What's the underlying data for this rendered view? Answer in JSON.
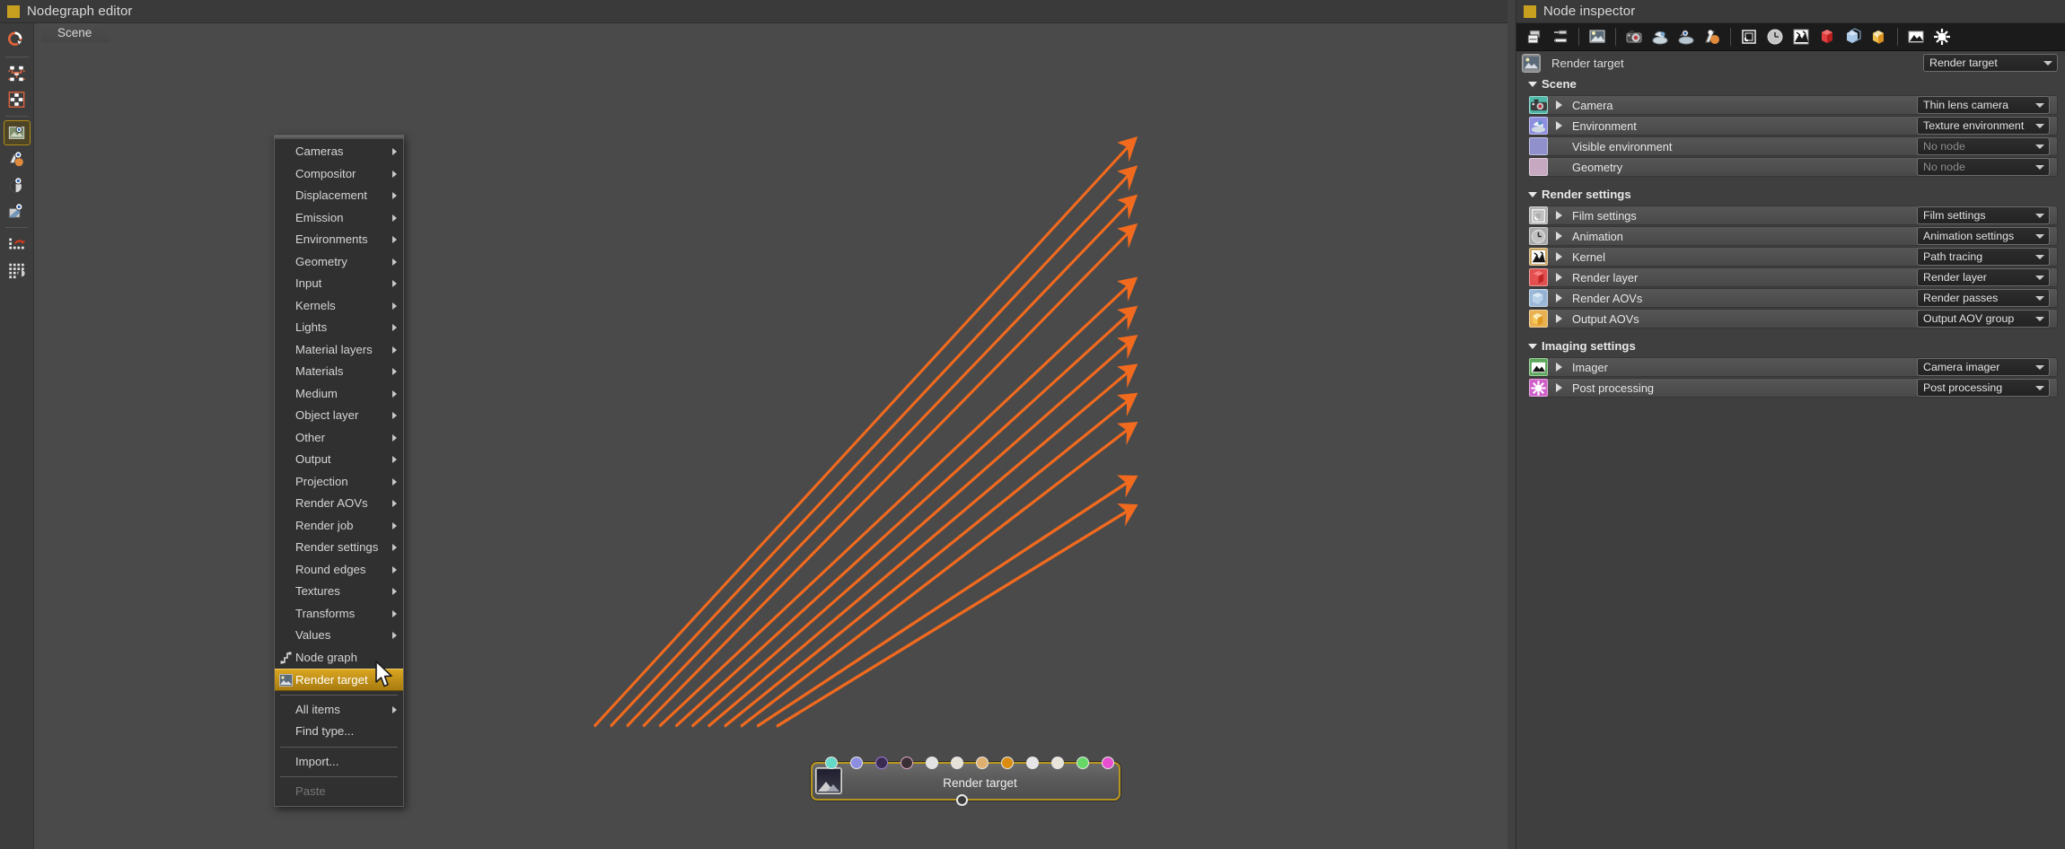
{
  "nodegraph": {
    "title": "Nodegraph editor",
    "tab": "Scene",
    "tool_rail": [
      {
        "name": "select-tool",
        "icon": "cursor-select-icon"
      },
      {
        "name": "layout-horizontal-tool",
        "icon": "layout-horizontal-icon"
      },
      {
        "name": "layout-vertical-tool",
        "icon": "layout-vertical-icon"
      },
      {
        "name": "render-target-tool",
        "icon": "render-target-icon"
      },
      {
        "name": "material-preview-tool",
        "icon": "material-ball-icon"
      },
      {
        "name": "geometry-preview-tool",
        "icon": "geometry-sphere-icon"
      },
      {
        "name": "texture-preview-tool",
        "icon": "texture-preview-icon"
      },
      {
        "name": "snap-tool",
        "icon": "snap-grid-icon"
      },
      {
        "name": "grid-tool",
        "icon": "grid-icon"
      }
    ],
    "node": {
      "label": "Render target",
      "icon": "render-target-thumbnail",
      "ports": [
        {
          "name": "camera-port",
          "color": "#66d8c8"
        },
        {
          "name": "environment-port",
          "color": "#8d8ee0"
        },
        {
          "name": "visible-environment-port",
          "color": "#3a2b52",
          "ring": "#9d7fd6"
        },
        {
          "name": "geometry-port",
          "color": "#3a2f34",
          "ring": "#e0a8c8"
        },
        {
          "name": "film-settings-port",
          "color": "#e2e2e2"
        },
        {
          "name": "animation-port",
          "color": "#e6e2d8"
        },
        {
          "name": "kernel-port",
          "color": "#e0b070"
        },
        {
          "name": "render-layer-port",
          "color": "#d98c10"
        },
        {
          "name": "render-aovs-port",
          "color": "#e6e6e6"
        },
        {
          "name": "output-aovs-port",
          "color": "#e8e4da"
        },
        {
          "name": "imager-port",
          "color": "#66d866"
        },
        {
          "name": "post-processing-port",
          "color": "#e84fd0"
        }
      ],
      "output_port": {
        "name": "output-port"
      }
    },
    "context_menu": {
      "items": [
        {
          "label": "Cameras",
          "submenu": true
        },
        {
          "label": "Compositor",
          "submenu": true
        },
        {
          "label": "Displacement",
          "submenu": true
        },
        {
          "label": "Emission",
          "submenu": true
        },
        {
          "label": "Environments",
          "submenu": true
        },
        {
          "label": "Geometry",
          "submenu": true
        },
        {
          "label": "Input",
          "submenu": true
        },
        {
          "label": "Kernels",
          "submenu": true
        },
        {
          "label": "Lights",
          "submenu": true
        },
        {
          "label": "Material layers",
          "submenu": true
        },
        {
          "label": "Materials",
          "submenu": true
        },
        {
          "label": "Medium",
          "submenu": true
        },
        {
          "label": "Object layer",
          "submenu": true
        },
        {
          "label": "Other",
          "submenu": true
        },
        {
          "label": "Output",
          "submenu": true
        },
        {
          "label": "Projection",
          "submenu": true
        },
        {
          "label": "Render AOVs",
          "submenu": true
        },
        {
          "label": "Render job",
          "submenu": true
        },
        {
          "label": "Render settings",
          "submenu": true
        },
        {
          "label": "Round edges",
          "submenu": true
        },
        {
          "label": "Textures",
          "submenu": true
        },
        {
          "label": "Transforms",
          "submenu": true
        },
        {
          "label": "Values",
          "submenu": true
        },
        {
          "label": "Node graph",
          "submenu": false,
          "icon": "node-graph-icon"
        },
        {
          "label": "Render target",
          "submenu": false,
          "icon": "render-target-icon",
          "selected": true
        },
        {
          "separator": true
        },
        {
          "label": "All items",
          "submenu": true
        },
        {
          "label": "Find type...",
          "submenu": false
        },
        {
          "separator": true
        },
        {
          "label": "Import...",
          "submenu": false
        },
        {
          "separator": true
        },
        {
          "label": "Paste",
          "submenu": false,
          "disabled": true
        }
      ]
    }
  },
  "inspector": {
    "title": "Node inspector",
    "toolbar": [
      {
        "name": "new-node-button",
        "icon": "new-node-icon"
      },
      {
        "name": "align-nodes-button",
        "icon": "align-nodes-icon"
      },
      {
        "separator": true
      },
      {
        "name": "render-target-button",
        "icon": "render-target-icon"
      },
      {
        "separator": true
      },
      {
        "name": "camera-button",
        "icon": "camera-icon"
      },
      {
        "name": "environment-button",
        "icon": "environment-icon"
      },
      {
        "name": "visible-environment-button",
        "icon": "visible-environment-icon"
      },
      {
        "name": "material-button",
        "icon": "material-ball-icon"
      },
      {
        "separator": true
      },
      {
        "name": "film-settings-button",
        "icon": "film-settings-icon"
      },
      {
        "name": "animation-button",
        "icon": "clock-icon"
      },
      {
        "name": "kernel-button",
        "icon": "kernel-icon"
      },
      {
        "name": "render-layer-button",
        "icon": "red-cube-icon"
      },
      {
        "name": "render-aovs-button",
        "icon": "blue-cube-icon"
      },
      {
        "name": "output-aovs-button",
        "icon": "orange-cube-icon"
      },
      {
        "separator": true
      },
      {
        "name": "imager-button",
        "icon": "imager-icon"
      },
      {
        "name": "post-processing-button",
        "icon": "post-processing-icon"
      }
    ],
    "header": {
      "icon": "render-target-icon",
      "name": "Render target",
      "type_value": "Render target"
    },
    "groups": [
      {
        "title": "Scene",
        "rows": [
          {
            "label": "Camera",
            "value": "Thin lens camera",
            "expandable": true,
            "muted": false,
            "icon": "camera-icon",
            "icon_bg": "#4fb8a8"
          },
          {
            "label": "Environment",
            "value": "Texture environment",
            "expandable": true,
            "muted": false,
            "icon": "environment-icon",
            "icon_bg": "#8d8ee0"
          },
          {
            "label": "Visible environment",
            "value": "No node",
            "expandable": false,
            "muted": true,
            "icon": "visible-environment-icon",
            "icon_bg": "#9090cc"
          },
          {
            "label": "Geometry",
            "value": "No node",
            "expandable": false,
            "muted": true,
            "icon": "geometry-icon",
            "icon_bg": "#c6a8c0"
          }
        ]
      },
      {
        "title": "Render settings",
        "rows": [
          {
            "label": "Film settings",
            "value": "Film settings",
            "expandable": true,
            "muted": false,
            "icon": "film-settings-icon",
            "icon_bg": "#b0b0b0"
          },
          {
            "label": "Animation",
            "value": "Animation settings",
            "expandable": true,
            "muted": false,
            "icon": "clock-icon",
            "icon_bg": "#a8a8a8"
          },
          {
            "label": "Kernel",
            "value": "Path tracing",
            "expandable": true,
            "muted": false,
            "icon": "kernel-icon",
            "icon_bg": "#c9a35c"
          },
          {
            "label": "Render layer",
            "value": "Render layer",
            "expandable": true,
            "muted": false,
            "icon": "red-cube-icon",
            "icon_bg": "#e05050"
          },
          {
            "label": "Render AOVs",
            "value": "Render passes",
            "expandable": true,
            "muted": false,
            "icon": "blue-cube-icon",
            "icon_bg": "#9bb8d8"
          },
          {
            "label": "Output AOVs",
            "value": "Output AOV group",
            "expandable": true,
            "muted": false,
            "icon": "orange-cube-icon",
            "icon_bg": "#e8b050"
          }
        ]
      },
      {
        "title": "Imaging settings",
        "rows": [
          {
            "label": "Imager",
            "value": "Camera imager",
            "expandable": true,
            "muted": false,
            "icon": "imager-icon",
            "icon_bg": "#5aa85a"
          },
          {
            "label": "Post processing",
            "value": "Post processing",
            "expandable": true,
            "muted": false,
            "icon": "post-processing-icon",
            "icon_bg": "#d060c8"
          }
        ]
      }
    ]
  },
  "colors": {
    "wire": "#f26a1e",
    "accent": "#c8a020",
    "panel_bg": "#3f3f3f",
    "canvas_bg": "#4a4a4a"
  }
}
